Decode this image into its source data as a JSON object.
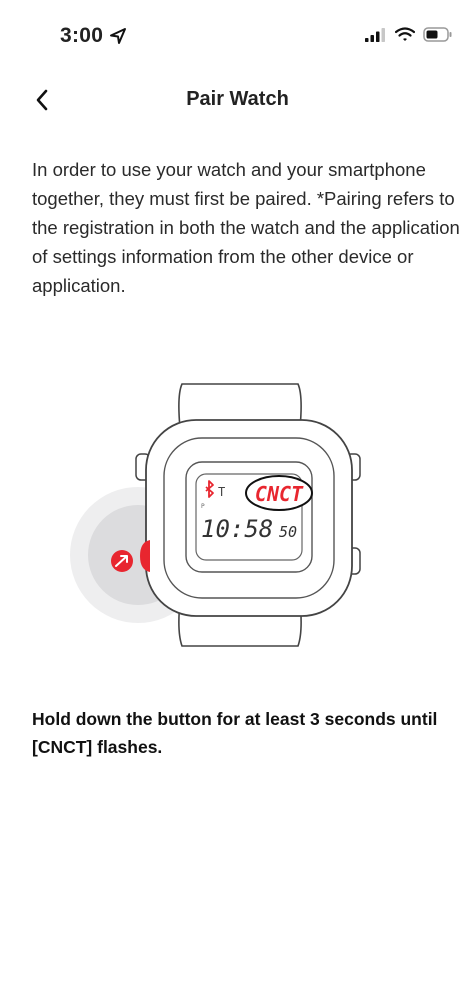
{
  "status_bar": {
    "time": "3:00",
    "icons": [
      "location-arrow-icon",
      "cellular-signal-icon",
      "wifi-icon",
      "battery-icon"
    ]
  },
  "nav": {
    "back_icon": "chevron-left-icon",
    "title": "Pair Watch"
  },
  "intro": {
    "text": "In order to use your watch and your smartphone together, they must first be paired. *Pairing refers to the registration in both the watch and the application of settings information from the other device or application."
  },
  "illustration": {
    "display_top": "CNCT",
    "display_time": "10:58",
    "display_seconds": "50",
    "accent_color": "#e8262f"
  },
  "instruction": {
    "text": "Hold down the button for at least 3 seconds until [CNCT] flashes."
  }
}
